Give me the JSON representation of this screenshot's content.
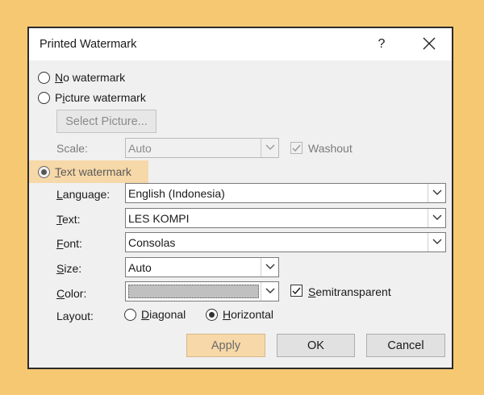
{
  "dialog": {
    "title": "Printed Watermark",
    "help_glyph": "?",
    "close_icon": "close-icon"
  },
  "options": {
    "no_watermark": "No watermark",
    "picture_watermark": "Picture watermark",
    "text_watermark": "Text watermark",
    "selected": "text_watermark"
  },
  "picture": {
    "select_button": "Select Picture...",
    "scale_label": "Scale:",
    "scale_value": "Auto",
    "washout_label": "Washout",
    "washout_checked": true
  },
  "text": {
    "language_label": "Language:",
    "language_value": "English (Indonesia)",
    "text_label": "Text:",
    "text_value": "LES KOMPI",
    "font_label": "Font:",
    "font_value": "Consolas",
    "size_label": "Size:",
    "size_value": "Auto",
    "color_label": "Color:",
    "color_value": "#c0c0c0",
    "semitransparent_label": "Semitransparent",
    "semitransparent_checked": true,
    "layout_label": "Layout:",
    "layout_diagonal": "Diagonal",
    "layout_horizontal": "Horizontal",
    "layout_selected": "horizontal"
  },
  "buttons": {
    "apply": "Apply",
    "ok": "OK",
    "cancel": "Cancel"
  },
  "colors": {
    "background": "#f7c872",
    "highlight": "#f7d8a8",
    "dialog_bg": "#f0f0f0"
  }
}
